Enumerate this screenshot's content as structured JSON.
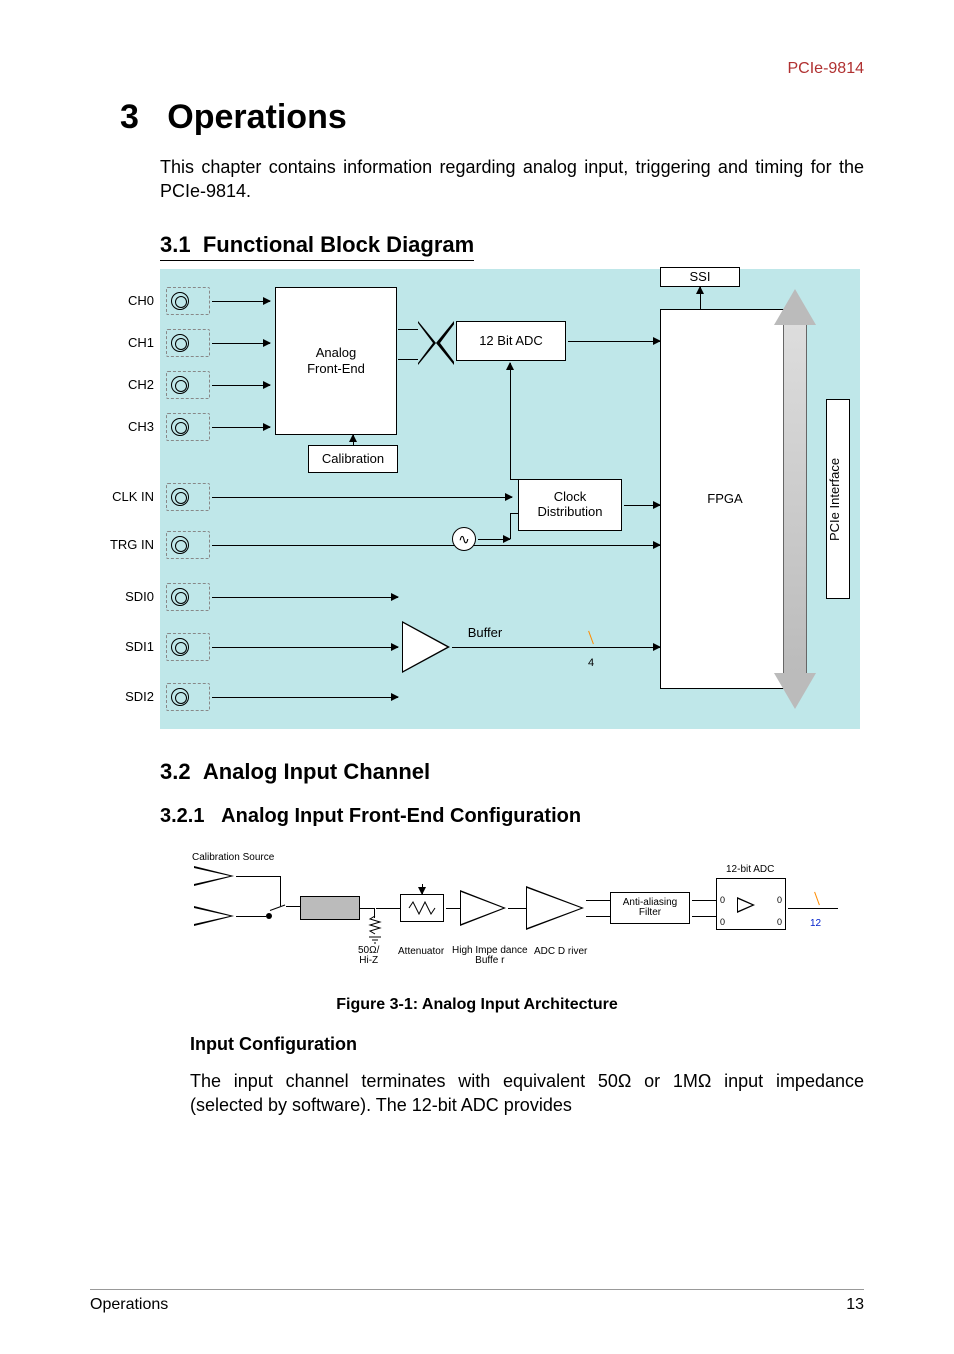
{
  "header": {
    "product": "PCIe-9814"
  },
  "chapter": {
    "number": "3",
    "title": "Operations"
  },
  "intro": "This chapter contains information regarding analog input, triggering and timing for the PCIe-9814.",
  "sections": {
    "s31": {
      "num": "3.1",
      "title": "Functional Block Diagram"
    },
    "s32": {
      "num": "3.2",
      "title": "Analog Input Channel"
    },
    "s321": {
      "num": "3.2.1",
      "title": "Analog Input Front-End Configuration"
    }
  },
  "diagram1": {
    "ports": [
      "CH0",
      "CH1",
      "CH2",
      "CH3",
      "CLK IN",
      "TRG IN",
      "SDI0",
      "SDI1",
      "SDI2"
    ],
    "boxes": {
      "afe": "Analog\nFront-End",
      "adc": "12 Bit ADC",
      "cal": "Calibration",
      "clk": "Clock\nDistribution",
      "buf": "Buffer",
      "fpga": "FPGA",
      "ssi": "SSI",
      "pcie": "PCIe Interface"
    },
    "slash_count": "4"
  },
  "diagram2": {
    "labels": {
      "calsrc": "Calibration Source",
      "imp": "50Ω/\nHi-Z",
      "atten": "Attenuator",
      "hibuf": "High Impe dance\nBuffe r",
      "adcdrv": "ADC D river",
      "filter": "Anti-aliasing\nFilter",
      "adc": "12-bit ADC",
      "bits": "12",
      "zero": "0"
    }
  },
  "figure_caption": "Figure 3-1: Analog Input Architecture",
  "input_cfg": {
    "head": "Input Configuration",
    "body": "The input channel terminates with equivalent 50Ω or 1MΩ input impedance (selected by software). The 12-bit ADC provides"
  },
  "footer": {
    "left": "Operations",
    "right": "13"
  }
}
